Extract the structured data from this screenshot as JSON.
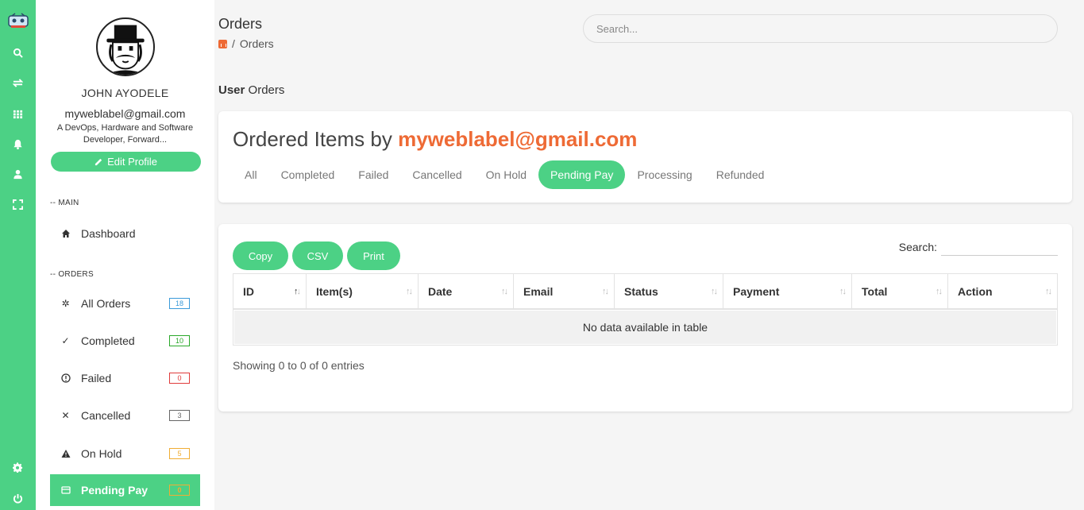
{
  "rail": {
    "items": [
      {
        "name": "logo-icon"
      },
      {
        "name": "search-icon"
      },
      {
        "name": "swap-icon"
      },
      {
        "name": "grid-icon"
      },
      {
        "name": "bell-icon"
      },
      {
        "name": "user-icon"
      },
      {
        "name": "fullscreen-icon"
      },
      {
        "name": "gear-icon"
      },
      {
        "name": "power-icon"
      }
    ]
  },
  "profile": {
    "name": "JOHN AYODELE",
    "email": "myweblabel@gmail.com",
    "bio": "A DevOps, Hardware and Software Developer, Forward...",
    "edit_label": "Edit Profile"
  },
  "sidebar": {
    "main_label": "-- MAIN",
    "dashboard_label": "Dashboard",
    "orders_label": "-- ORDERS",
    "items": [
      {
        "label": "All Orders",
        "count": "18",
        "color": "#3a9ad9",
        "icon": "asterisk-icon"
      },
      {
        "label": "Completed",
        "count": "10",
        "color": "#2aa829",
        "icon": "check-icon"
      },
      {
        "label": "Failed",
        "count": "0",
        "color": "#e03b3b",
        "icon": "alert-circle-icon"
      },
      {
        "label": "Cancelled",
        "count": "3",
        "color": "#666666",
        "icon": "close-icon"
      },
      {
        "label": "On Hold",
        "count": "5",
        "color": "#f0ad34",
        "icon": "warning-icon"
      },
      {
        "label": "Pending Pay",
        "count": "0",
        "color": "#f0ad34",
        "icon": "card-icon",
        "active": true
      }
    ]
  },
  "header": {
    "title": "Orders",
    "breadcrumb_current": "Orders",
    "breadcrumb_sep": "/",
    "search_placeholder": "Search..."
  },
  "subheading": {
    "bold": "User",
    "rest": " Orders"
  },
  "orders_card": {
    "title_prefix": "Ordered Items by ",
    "title_email": "myweblabel@gmail.com",
    "tabs": [
      "All",
      "Completed",
      "Failed",
      "Cancelled",
      "On Hold",
      "Pending Pay",
      "Processing",
      "Refunded"
    ],
    "active_tab": "Pending Pay"
  },
  "table_card": {
    "buttons": [
      "Copy",
      "CSV",
      "Print"
    ],
    "search_label": "Search:",
    "columns": [
      "ID",
      "Item(s)",
      "Date",
      "Email",
      "Status",
      "Payment",
      "Total",
      "Action"
    ],
    "empty_text": "No data available in table",
    "showing_text": "Showing 0 to 0 of 0 entries"
  },
  "colors": {
    "accent": "#4cd185",
    "brand_orange": "#ee6a35"
  }
}
